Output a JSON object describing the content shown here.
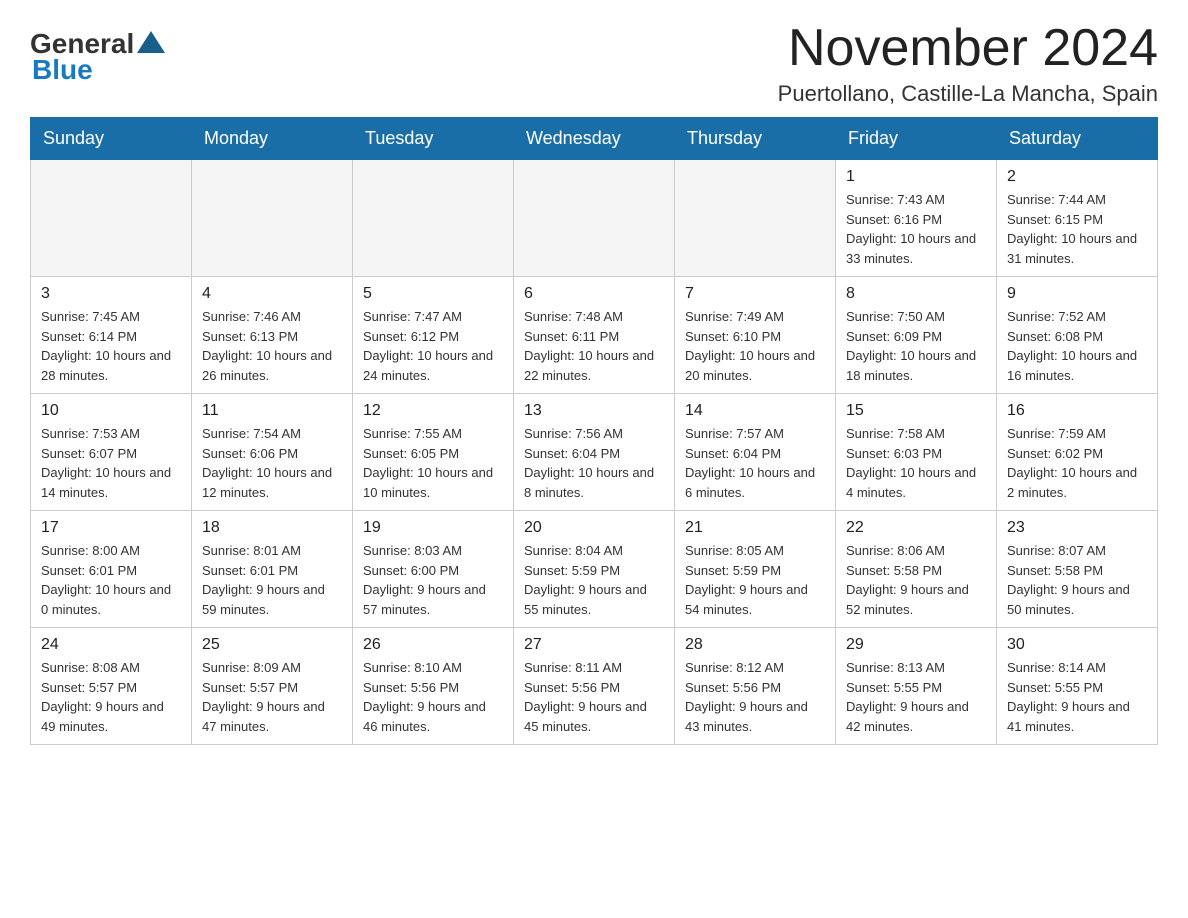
{
  "header": {
    "logo_general": "General",
    "logo_blue": "Blue",
    "month_title": "November 2024",
    "location": "Puertollano, Castille-La Mancha, Spain"
  },
  "days_of_week": [
    "Sunday",
    "Monday",
    "Tuesday",
    "Wednesday",
    "Thursday",
    "Friday",
    "Saturday"
  ],
  "weeks": [
    {
      "days": [
        {
          "empty": true
        },
        {
          "empty": true
        },
        {
          "empty": true
        },
        {
          "empty": true
        },
        {
          "empty": true
        },
        {
          "num": "1",
          "sunrise": "Sunrise: 7:43 AM",
          "sunset": "Sunset: 6:16 PM",
          "daylight": "Daylight: 10 hours and 33 minutes."
        },
        {
          "num": "2",
          "sunrise": "Sunrise: 7:44 AM",
          "sunset": "Sunset: 6:15 PM",
          "daylight": "Daylight: 10 hours and 31 minutes."
        }
      ]
    },
    {
      "days": [
        {
          "num": "3",
          "sunrise": "Sunrise: 7:45 AM",
          "sunset": "Sunset: 6:14 PM",
          "daylight": "Daylight: 10 hours and 28 minutes."
        },
        {
          "num": "4",
          "sunrise": "Sunrise: 7:46 AM",
          "sunset": "Sunset: 6:13 PM",
          "daylight": "Daylight: 10 hours and 26 minutes."
        },
        {
          "num": "5",
          "sunrise": "Sunrise: 7:47 AM",
          "sunset": "Sunset: 6:12 PM",
          "daylight": "Daylight: 10 hours and 24 minutes."
        },
        {
          "num": "6",
          "sunrise": "Sunrise: 7:48 AM",
          "sunset": "Sunset: 6:11 PM",
          "daylight": "Daylight: 10 hours and 22 minutes."
        },
        {
          "num": "7",
          "sunrise": "Sunrise: 7:49 AM",
          "sunset": "Sunset: 6:10 PM",
          "daylight": "Daylight: 10 hours and 20 minutes."
        },
        {
          "num": "8",
          "sunrise": "Sunrise: 7:50 AM",
          "sunset": "Sunset: 6:09 PM",
          "daylight": "Daylight: 10 hours and 18 minutes."
        },
        {
          "num": "9",
          "sunrise": "Sunrise: 7:52 AM",
          "sunset": "Sunset: 6:08 PM",
          "daylight": "Daylight: 10 hours and 16 minutes."
        }
      ]
    },
    {
      "days": [
        {
          "num": "10",
          "sunrise": "Sunrise: 7:53 AM",
          "sunset": "Sunset: 6:07 PM",
          "daylight": "Daylight: 10 hours and 14 minutes."
        },
        {
          "num": "11",
          "sunrise": "Sunrise: 7:54 AM",
          "sunset": "Sunset: 6:06 PM",
          "daylight": "Daylight: 10 hours and 12 minutes."
        },
        {
          "num": "12",
          "sunrise": "Sunrise: 7:55 AM",
          "sunset": "Sunset: 6:05 PM",
          "daylight": "Daylight: 10 hours and 10 minutes."
        },
        {
          "num": "13",
          "sunrise": "Sunrise: 7:56 AM",
          "sunset": "Sunset: 6:04 PM",
          "daylight": "Daylight: 10 hours and 8 minutes."
        },
        {
          "num": "14",
          "sunrise": "Sunrise: 7:57 AM",
          "sunset": "Sunset: 6:04 PM",
          "daylight": "Daylight: 10 hours and 6 minutes."
        },
        {
          "num": "15",
          "sunrise": "Sunrise: 7:58 AM",
          "sunset": "Sunset: 6:03 PM",
          "daylight": "Daylight: 10 hours and 4 minutes."
        },
        {
          "num": "16",
          "sunrise": "Sunrise: 7:59 AM",
          "sunset": "Sunset: 6:02 PM",
          "daylight": "Daylight: 10 hours and 2 minutes."
        }
      ]
    },
    {
      "days": [
        {
          "num": "17",
          "sunrise": "Sunrise: 8:00 AM",
          "sunset": "Sunset: 6:01 PM",
          "daylight": "Daylight: 10 hours and 0 minutes."
        },
        {
          "num": "18",
          "sunrise": "Sunrise: 8:01 AM",
          "sunset": "Sunset: 6:01 PM",
          "daylight": "Daylight: 9 hours and 59 minutes."
        },
        {
          "num": "19",
          "sunrise": "Sunrise: 8:03 AM",
          "sunset": "Sunset: 6:00 PM",
          "daylight": "Daylight: 9 hours and 57 minutes."
        },
        {
          "num": "20",
          "sunrise": "Sunrise: 8:04 AM",
          "sunset": "Sunset: 5:59 PM",
          "daylight": "Daylight: 9 hours and 55 minutes."
        },
        {
          "num": "21",
          "sunrise": "Sunrise: 8:05 AM",
          "sunset": "Sunset: 5:59 PM",
          "daylight": "Daylight: 9 hours and 54 minutes."
        },
        {
          "num": "22",
          "sunrise": "Sunrise: 8:06 AM",
          "sunset": "Sunset: 5:58 PM",
          "daylight": "Daylight: 9 hours and 52 minutes."
        },
        {
          "num": "23",
          "sunrise": "Sunrise: 8:07 AM",
          "sunset": "Sunset: 5:58 PM",
          "daylight": "Daylight: 9 hours and 50 minutes."
        }
      ]
    },
    {
      "days": [
        {
          "num": "24",
          "sunrise": "Sunrise: 8:08 AM",
          "sunset": "Sunset: 5:57 PM",
          "daylight": "Daylight: 9 hours and 49 minutes."
        },
        {
          "num": "25",
          "sunrise": "Sunrise: 8:09 AM",
          "sunset": "Sunset: 5:57 PM",
          "daylight": "Daylight: 9 hours and 47 minutes."
        },
        {
          "num": "26",
          "sunrise": "Sunrise: 8:10 AM",
          "sunset": "Sunset: 5:56 PM",
          "daylight": "Daylight: 9 hours and 46 minutes."
        },
        {
          "num": "27",
          "sunrise": "Sunrise: 8:11 AM",
          "sunset": "Sunset: 5:56 PM",
          "daylight": "Daylight: 9 hours and 45 minutes."
        },
        {
          "num": "28",
          "sunrise": "Sunrise: 8:12 AM",
          "sunset": "Sunset: 5:56 PM",
          "daylight": "Daylight: 9 hours and 43 minutes."
        },
        {
          "num": "29",
          "sunrise": "Sunrise: 8:13 AM",
          "sunset": "Sunset: 5:55 PM",
          "daylight": "Daylight: 9 hours and 42 minutes."
        },
        {
          "num": "30",
          "sunrise": "Sunrise: 8:14 AM",
          "sunset": "Sunset: 5:55 PM",
          "daylight": "Daylight: 9 hours and 41 minutes."
        }
      ]
    }
  ]
}
